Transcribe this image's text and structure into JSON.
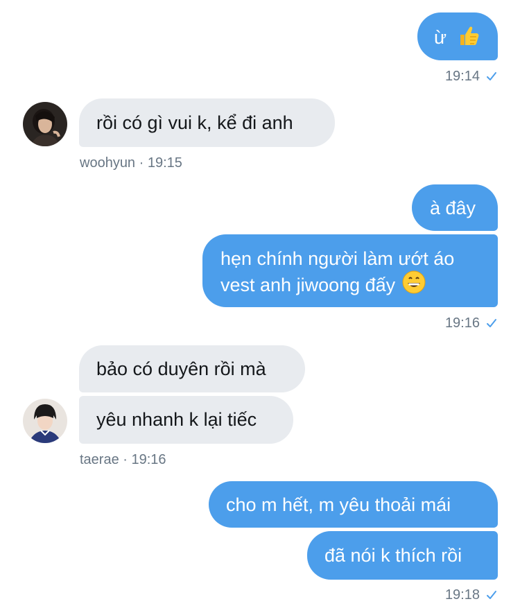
{
  "messages": [
    {
      "id": "m1",
      "direction": "outgoing",
      "text": "ừ",
      "emoji": "thumbs-up"
    },
    {
      "id": "m2",
      "direction": "incoming",
      "sender": "woohyun",
      "text": "rồi có gì vui k, kể đi anh"
    },
    {
      "id": "m3",
      "direction": "outgoing",
      "text": "à đây"
    },
    {
      "id": "m4",
      "direction": "outgoing",
      "line1": "hẹn chính người làm ướt áo",
      "line2": "vest anh jiwoong đấy",
      "emoji": "grinning-face"
    },
    {
      "id": "m5",
      "direction": "incoming",
      "sender": "taerae",
      "text": "bảo có duyên rồi mà"
    },
    {
      "id": "m6",
      "direction": "incoming",
      "sender": "taerae",
      "text": "yêu nhanh k lại tiếc"
    },
    {
      "id": "m7",
      "direction": "outgoing",
      "text": "cho m hết, m yêu thoải mái"
    },
    {
      "id": "m8",
      "direction": "outgoing",
      "text": "đã nói k thích rồi"
    }
  ],
  "meta": {
    "t1": "19:14",
    "woohyun": "woohyun · 19:15",
    "t2": "19:16",
    "taerae": "taerae · 19:16",
    "t3": "19:18"
  },
  "colors": {
    "outgoing_bubble": "#4c9eeb",
    "incoming_bubble": "#e8ebef",
    "meta_text": "#687684",
    "read_check": "#4c9eeb"
  }
}
